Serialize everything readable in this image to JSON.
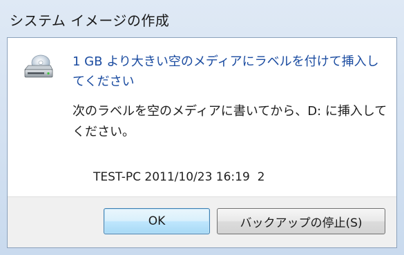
{
  "window": {
    "title": "システム イメージの作成"
  },
  "dialog": {
    "icon": "cd-drive-icon",
    "main_instruction": "1 GB より大きい空のメディアにラベルを付けて挿入してください",
    "body": "次のラベルを空のメディアに書いてから、D: に挿入してください。",
    "media_label": "TEST-PC 2011/10/23 16:19  2"
  },
  "buttons": {
    "ok_label": "OK",
    "stop_backup_label": "バックアップの停止(S)"
  },
  "colors": {
    "instruction_text": "#1a4ba0",
    "title_bar": "#dfe9f5",
    "footer": "#f0f0f0",
    "default_button_border": "#3c7fb1"
  }
}
